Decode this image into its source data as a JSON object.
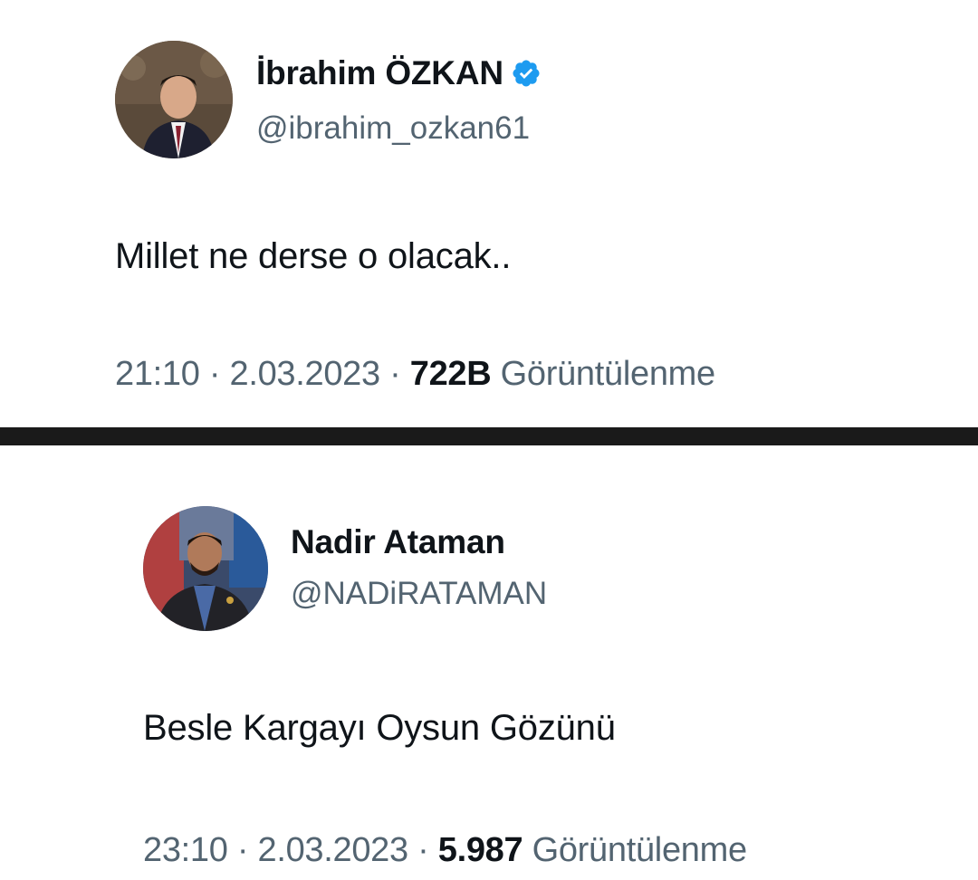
{
  "tweets": [
    {
      "display_name": "İbrahim ÖZKAN",
      "verified": true,
      "handle": "@ibrahim_ozkan61",
      "text": "Millet ne derse o olacak..",
      "time": "21:10",
      "separator": "·",
      "date": "2.03.2023",
      "views_count": "722B",
      "views_label": "Görüntülenme",
      "avatar_icon": "profile-photo"
    },
    {
      "display_name": "Nadir Ataman",
      "verified": false,
      "handle": "@NADiRATAMAN",
      "text": "Besle Kargayı Oysun Gözünü",
      "time": "23:10",
      "separator": "·",
      "date": "2.03.2023",
      "views_count": "5.987",
      "views_label": "Görüntülenme",
      "avatar_icon": "profile-photo"
    }
  ],
  "colors": {
    "verified_badge": "#1d9bf0",
    "primary_text": "#0f1419",
    "secondary_text": "#536471",
    "divider": "#1a1a1a"
  }
}
